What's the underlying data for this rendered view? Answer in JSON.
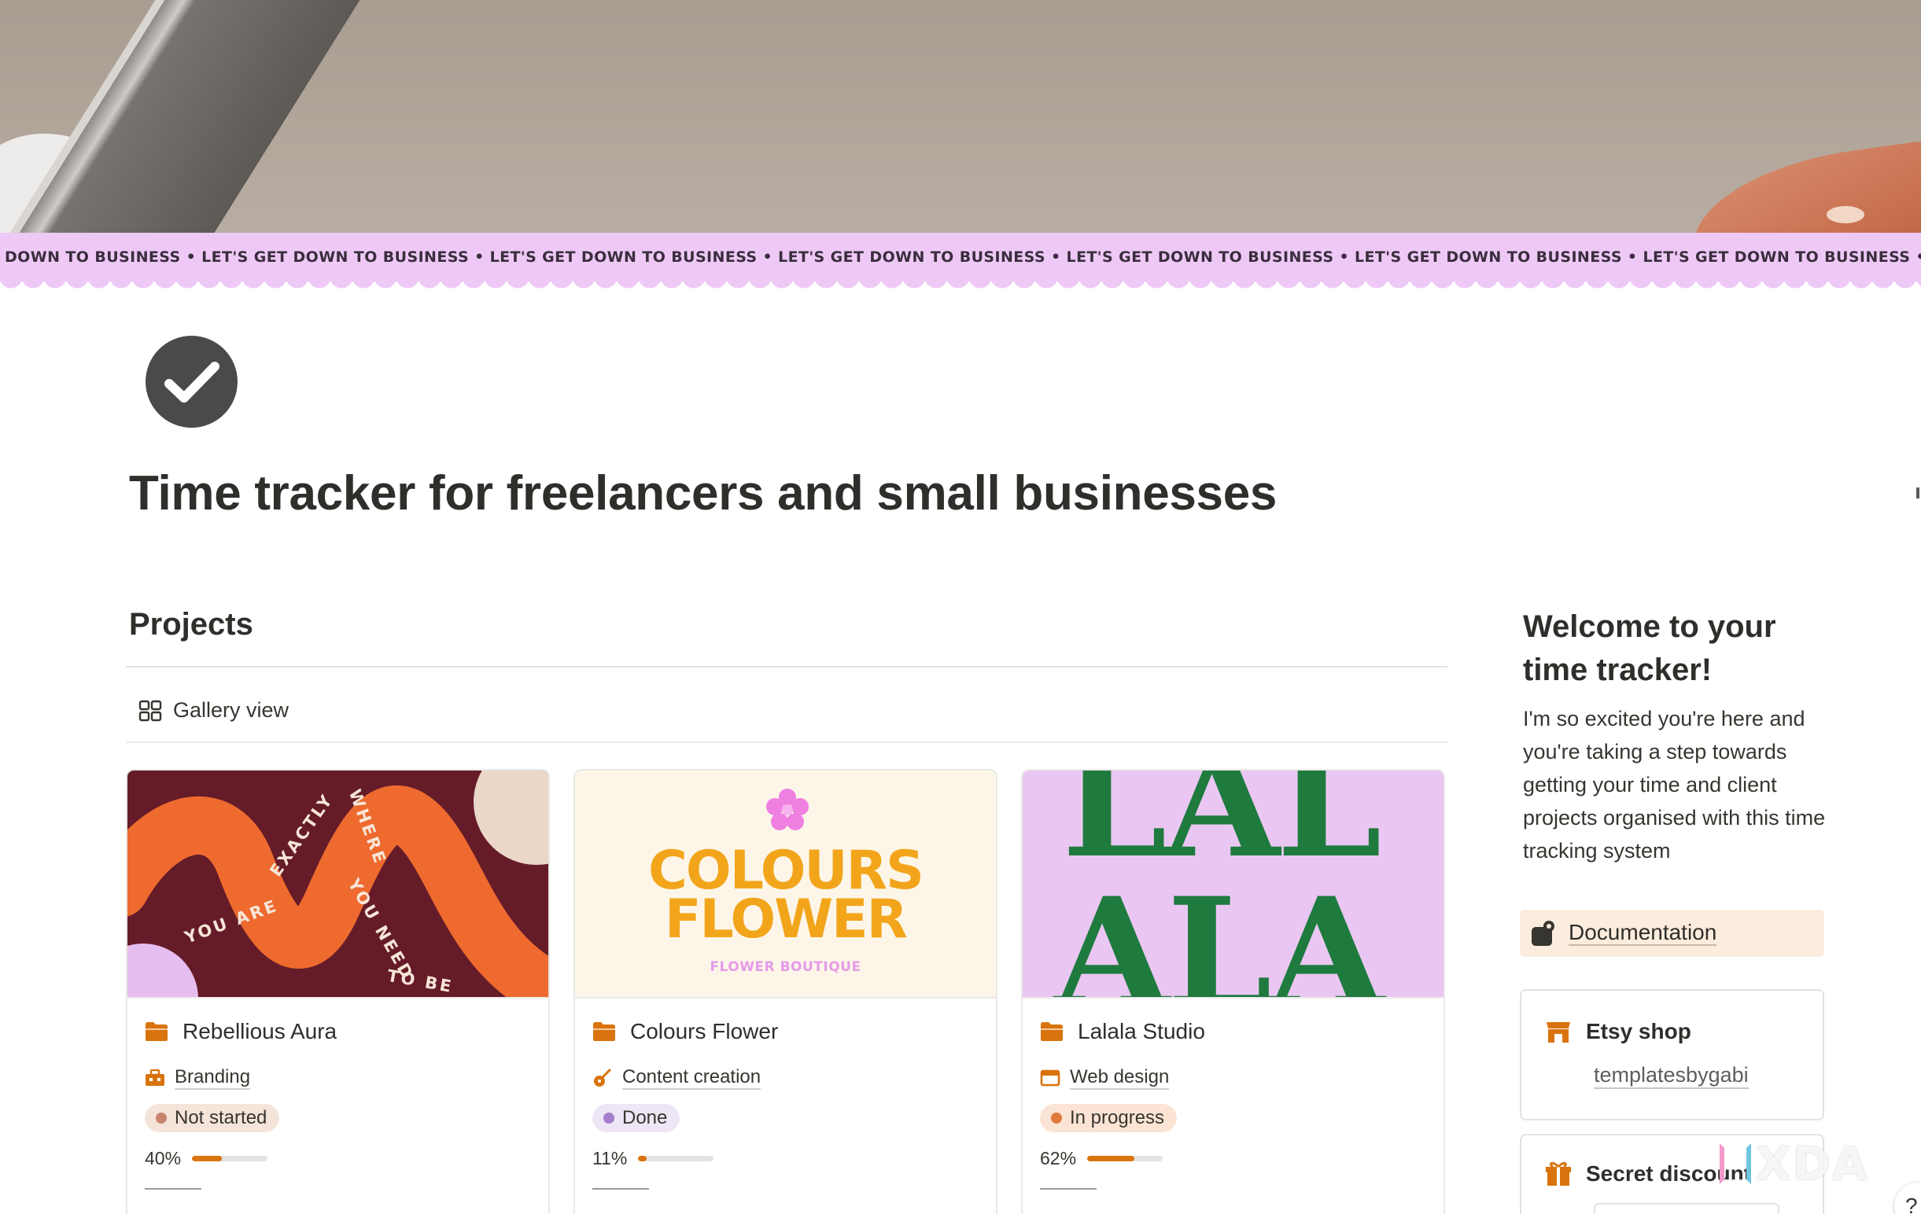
{
  "banner": {
    "text": "DOWN TO BUSINESS • LET'S GET DOWN TO BUSINESS • LET'S GET DOWN TO BUSINESS • LET'S GET DOWN TO BUSINESS • LET'S GET DOWN TO BUSINESS • LET'S GET DOWN TO BUSINESS • LET'S GET DOWN TO BUSINESS • LET'S GET DO"
  },
  "page": {
    "icon": "check-circle-icon",
    "title": "Time tracker for freelancers and small businesses"
  },
  "projects": {
    "title": "Projects",
    "view_label": "Gallery view",
    "cards": [
      {
        "name": "Rebellious Aura",
        "type": "Branding",
        "type_icon": "toolbox-icon",
        "status": "Not started",
        "status_bg": "#f4e4d9",
        "status_dot": "#c8846d",
        "progress_label": "40%",
        "progress": 0.4,
        "cover_words": [
          "YOU ARE",
          "EXACTLY",
          "WHERE",
          "YOU NEED",
          "TO BE"
        ]
      },
      {
        "name": "Colours Flower",
        "type": "Content creation",
        "type_icon": "guitar-icon",
        "status": "Done",
        "status_bg": "#eee6f6",
        "status_dot": "#a47dcb",
        "progress_label": "11%",
        "progress": 0.11,
        "cover_line1": "COLOURS",
        "cover_line2": "FLOWER",
        "cover_sub": "FLOWER BOUTIQUE"
      },
      {
        "name": "Lalala Studio",
        "type": "Web design",
        "type_icon": "browser-icon",
        "status": "In progress",
        "status_bg": "#fbe4d4",
        "status_dot": "#e07a3a",
        "progress_label": "62%",
        "progress": 0.62,
        "cover_line1": "LAL",
        "cover_line2": "ALA"
      }
    ]
  },
  "welcome": {
    "title": "Welcome to your time tracker!",
    "text": "I'm so excited you're here and you're taking a step towards getting your time and client projects organised with this time tracking system",
    "doc_label": "Documentation"
  },
  "etsy": {
    "title": "Etsy shop",
    "link": "templatesbygabi"
  },
  "discount": {
    "title": "Secret discount"
  },
  "watermark": {
    "text": "XDA"
  },
  "help": {
    "label": "?"
  },
  "colors": {
    "accent": "#d9730d",
    "banner": "#eec9f6",
    "callout": "#fbecdd"
  }
}
